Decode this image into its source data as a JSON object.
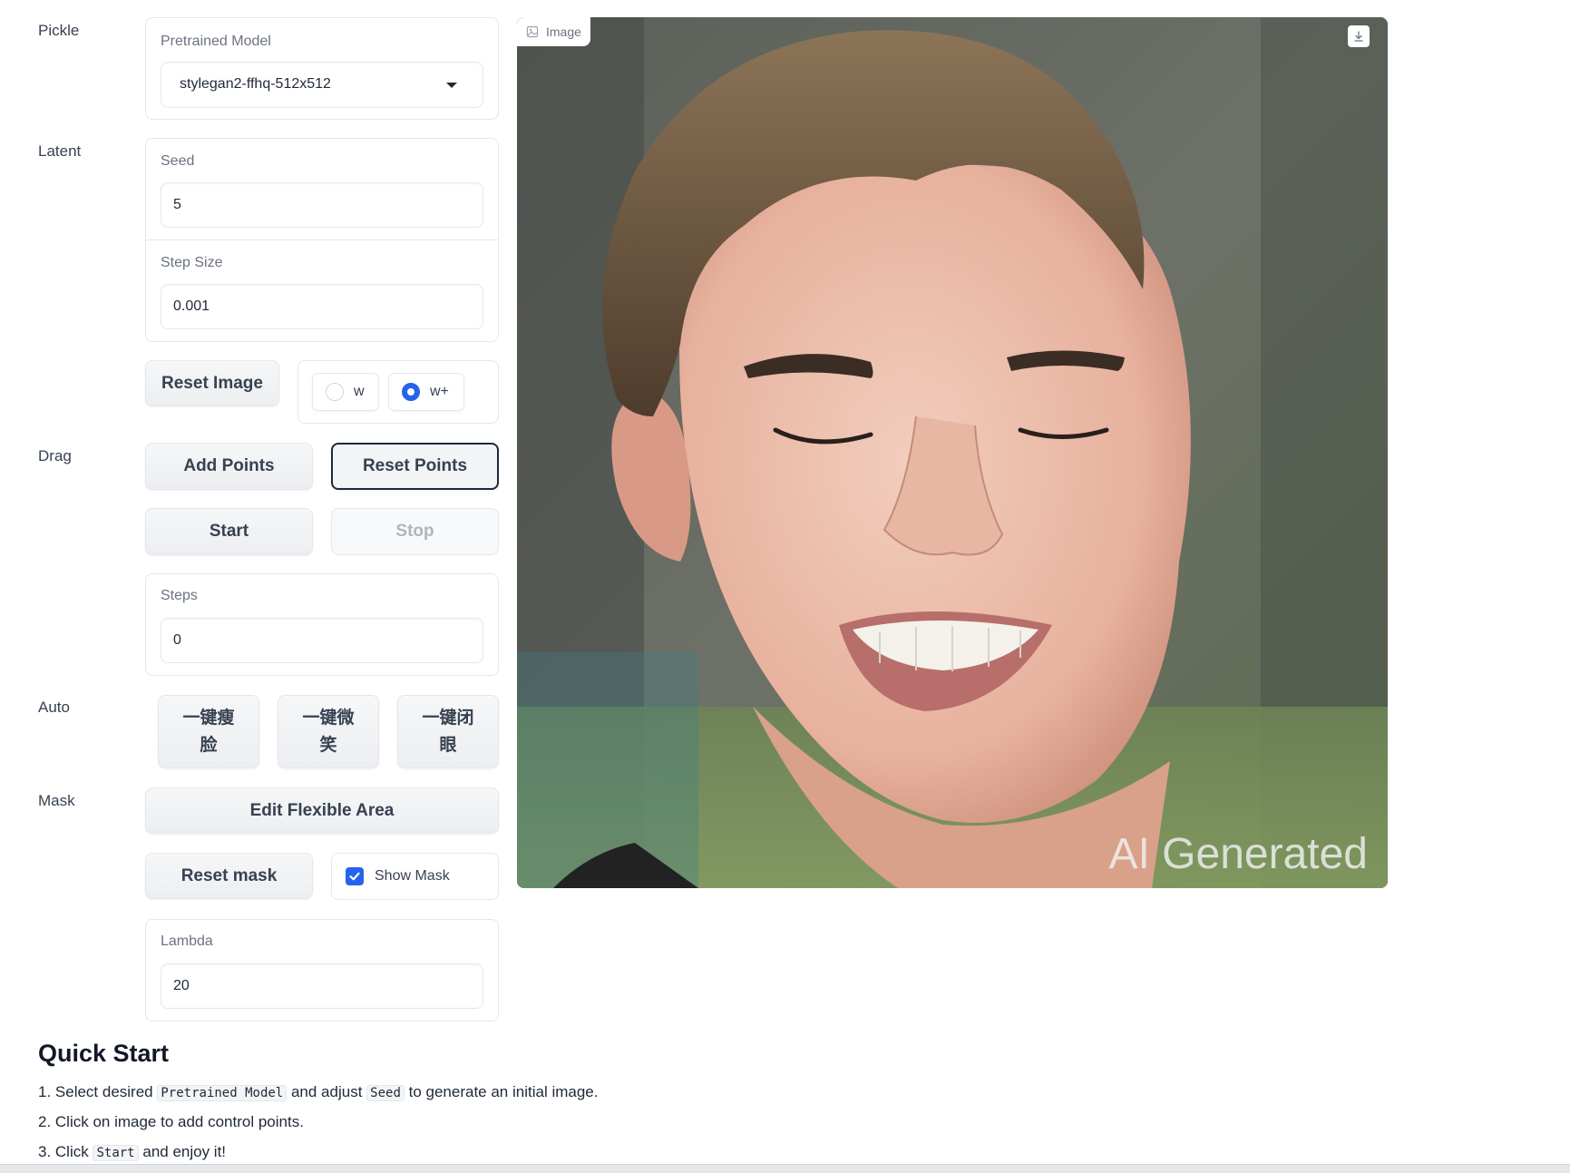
{
  "sections": {
    "pickle": "Pickle",
    "latent": "Latent",
    "drag": "Drag",
    "auto": "Auto",
    "mask": "Mask"
  },
  "pretrained_model": {
    "label": "Pretrained Model",
    "value": "stylegan2-ffhq-512x512"
  },
  "seed": {
    "label": "Seed",
    "value": "5"
  },
  "step_size": {
    "label": "Step Size",
    "value": "0.001"
  },
  "reset_image": "Reset Image",
  "latent_space": {
    "options": [
      {
        "label": "w",
        "selected": false
      },
      {
        "label": "w+",
        "selected": true
      }
    ]
  },
  "drag": {
    "add_points": "Add Points",
    "reset_points": "Reset Points",
    "start": "Start",
    "stop": "Stop",
    "steps_label": "Steps",
    "steps_value": "0"
  },
  "auto": {
    "thin_face": "一键瘦脸",
    "smile": "一键微笑",
    "close_eyes": "一键闭眼"
  },
  "mask": {
    "edit_flexible_area": "Edit Flexible Area",
    "reset_mask": "Reset mask",
    "show_mask_label": "Show Mask",
    "show_mask_checked": true,
    "lambda_label": "Lambda",
    "lambda_value": "20"
  },
  "image": {
    "tag": "Image",
    "watermark": "AI Generated"
  },
  "quick_start": {
    "title": "Quick Start",
    "step1_a": "1. Select desired",
    "step1_code1": "Pretrained Model",
    "step1_b": "and adjust",
    "step1_code2": "Seed",
    "step1_c": "to generate an initial image.",
    "step2": "2. Click on image to add control points.",
    "step3_a": "3. Click",
    "step3_code": "Start",
    "step3_b": "and enjoy it!"
  },
  "colors": {
    "accent": "#2563eb",
    "border": "#e5e7eb"
  },
  "icons": {
    "image_tag": "image-icon",
    "download": "download-icon",
    "dropdown": "chevron-down-icon"
  }
}
